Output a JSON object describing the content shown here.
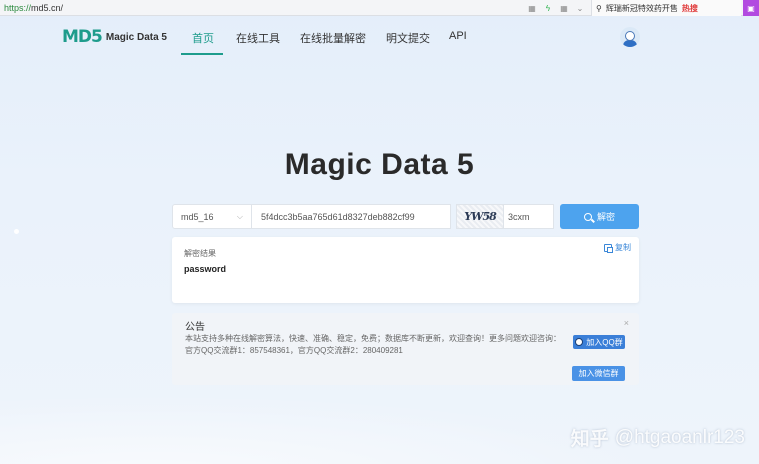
{
  "browser": {
    "url_scheme": "https://",
    "url_host": "md5.cn/",
    "search_text": "辉瑞新冠特效药开售",
    "hot_label": "热搜"
  },
  "nav": {
    "logo_mark": "MD5",
    "logo_text": "Magic Data 5",
    "items": [
      {
        "label": "首页",
        "active": true
      },
      {
        "label": "在线工具"
      },
      {
        "label": "在线批量解密"
      },
      {
        "label": "明文提交"
      },
      {
        "label": "API"
      }
    ]
  },
  "hero": {
    "title": "Magic Data 5"
  },
  "search": {
    "type_value": "md5_16",
    "hash_value": "5f4dcc3b5aa765d61d8327deb882cf99",
    "captcha_text": "YW58",
    "captcha_value": "3cxm",
    "decrypt_label": "解密"
  },
  "result": {
    "label": "解密结果",
    "value": "password",
    "copy_label": "复制"
  },
  "notice": {
    "title": "公告",
    "close": "×",
    "text": "本站支持多种在线解密算法，快速、准确、稳定，免费；数据库不断更新，欢迎查询！更多问题欢迎咨询：官方QQ交流群1：857548361，官方QQ交流群2：280409281",
    "qq_label": "加入QQ群",
    "wechat_label": "加入微信群"
  },
  "watermark": {
    "logo": "知乎",
    "text": "@htgaoanlr123"
  }
}
